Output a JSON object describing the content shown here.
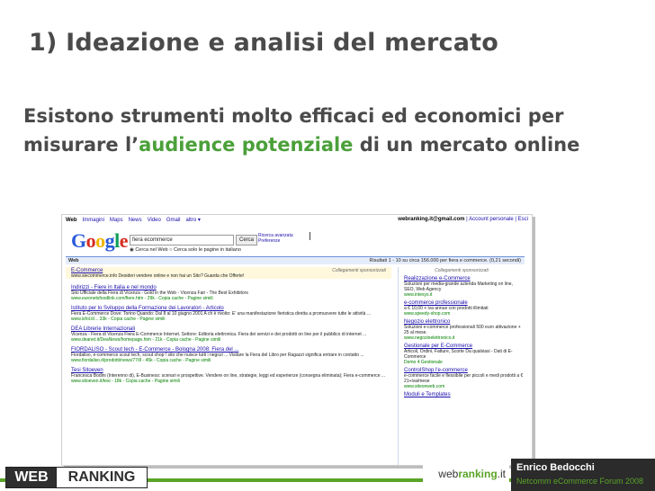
{
  "slide": {
    "title": "1) Ideazione e analisi del mercato",
    "body_pre": "Esistono strumenti molto efficaci ed economici per misurare l’",
    "body_highlight": "audience potenziale",
    "body_post": " di un    mercato online",
    "highlight_color": "#4ba03a"
  },
  "google": {
    "nav": [
      "Web",
      "Immagini",
      "Maps",
      "News",
      "Video",
      "Gmail",
      "altro ▾"
    ],
    "account": "webranking.it@gmail.com",
    "account_links": "| Account personale | Esci",
    "logo": "Google",
    "query": "fiera ecommerce",
    "search_button": "Cerca",
    "advanced": "Ricerca avanzata\nPreferenze",
    "radio": "◉ Cerca nel Web  ○ Cerca solo le pagine in italiano",
    "bar_label": "Web",
    "results_info": "Risultati 1 - 10 su circa 156.000 per fiera e commerce. (0,21 secondi)",
    "ad_title": "E-Commerce",
    "ad_desc": "www.siecommerce.info   Desideri vendere online e non hai un Sito? Guarda che Offerte!",
    "ad_sponsored": "Collegamenti sponsorizzati",
    "results": [
      {
        "title": "Indirizzi - Fiere in Italia e nel mondo",
        "desc": "Sito Ufficiale della Fiera di Vicenza - Gold in the Web - Vicenza Fair - The Best Exhibitors",
        "url": "www.euronetsfoodlink.com/fiere.htm - 29k - Copia cache - Pagine simili"
      },
      {
        "title": "Istituto per lo Sviluppo della Formazione dei Lavoratori - Articolo",
        "desc": "Fiera E-Commerce Dove: Torino Quando: Dal 8 al 10 giugno 2001 A ch è rivolto: E' una manifestazione fieristica diretta a promuovere tutte le attività ...",
        "url": "www.isfol.it/... 33k - Copia cache - Pagine simili"
      },
      {
        "title": "DEA Librerie Internazionali",
        "desc": "Vicenza - Fiera di Vicenza Fiera E-Commerce Internet. Settore: Editoria elettronica. Fiera dei servizi e dei prodotti on line per il pubblico di internet ...",
        "url": "www.deanet.it/DeaNews/homepage.htm - 21k - Copia cache - Pagine simili"
      },
      {
        "title": "FIORDALISO - Scout tech - E-Commerce - Bologna 2008: Fiera del ...",
        "desc": "Fiordaliso, e-commerce scout tech, scout shop ! sito che nuisce tutti i negozi ... Visitare la Fiera del Libro per Ragazzi significa entrare in contatto ...",
        "url": "www.fiordaliso.it/prodotti/news/77/8 - 45k - Copia cache - Pagine simili"
      },
      {
        "title": "Tesi Sitoeven",
        "desc": "Francesca Bodini (Interenno di), E-Business: scenari e prospettive. Vendere on line, strategie, leggi ed esperienze (consegna eliminata); Fiera e-commerce ...",
        "url": "www.sitoeven.it/tesi - 18k - Copia cache - Pagine simili"
      }
    ],
    "side_header": "Collegamenti sponsorizzati",
    "side_ads": [
      {
        "title": "Realizzazione e-Commerce",
        "desc": "Soluzioni per media-grande azienda Marketing on line, SEO, Web Agency",
        "url": "www.intesys.it"
      },
      {
        "title": "e-commerce professionale",
        "desc": "a € 10,00 + iva annue con prodotti illimitati",
        "url": "www.speedy-shop.com"
      },
      {
        "title": "Negozio elettronico",
        "desc": "Soluzioni e-commerce professionali 500 euro attivazione + 25 al mese.",
        "url": "www.negozioelettronico.it"
      },
      {
        "title": "Gestionale per E-Commerce",
        "desc": "Articoli, Ordini, Fatture, Scorte Da qualsiasi - Dati di E-Commerce",
        "url": "Demo 4 Gestionale"
      },
      {
        "title": "ControlShop l'e-commerce",
        "desc": "e-commerce facile e flessibile per piccoli e medi prodotti a € 21+iva/mese",
        "url": "www.siteonweb.com"
      },
      {
        "title": "Moduli e Templates",
        "desc": "",
        "url": ""
      }
    ]
  },
  "footer": {
    "logo_web": "WEB",
    "logo_ranking": "RANKING",
    "url_pre": "web",
    "url_bold": "ranking",
    "url_post": ".it",
    "author_name": "Enrico Bedocchi",
    "event": "Netcomm eCommerce Forum 2008",
    "accent": "#5aa427"
  }
}
